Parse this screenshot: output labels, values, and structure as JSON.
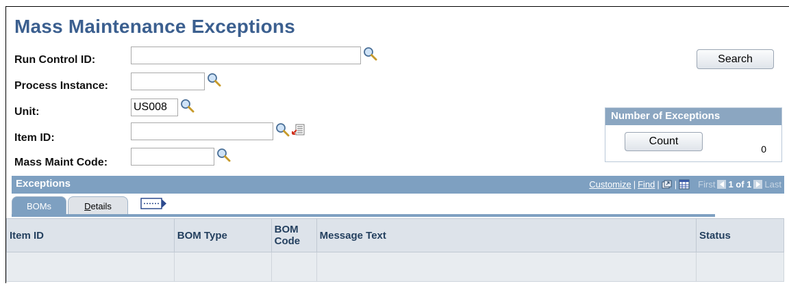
{
  "page": {
    "title": "Mass Maintenance Exceptions"
  },
  "form": {
    "run_control_id": {
      "label": "Run Control ID:",
      "value": ""
    },
    "process_instance": {
      "label": "Process Instance:",
      "value": ""
    },
    "unit": {
      "label": "Unit:",
      "value": "US008"
    },
    "item_id": {
      "label": "Item ID:",
      "value": ""
    },
    "mass_maint_code": {
      "label": "Mass Maint Code:",
      "value": ""
    }
  },
  "search_button": "Search",
  "number_of_exceptions": {
    "title": "Number of Exceptions",
    "count_button": "Count",
    "value": "0"
  },
  "exceptions": {
    "title": "Exceptions",
    "nav": {
      "customize": "Customize",
      "find": "Find",
      "first": "First",
      "page": "1 of 1",
      "last": "Last"
    },
    "tabs": [
      {
        "label": "BOMs"
      },
      {
        "label_prefix": "D",
        "label_rest": "etails"
      }
    ],
    "columns": [
      "Item ID",
      "BOM Type",
      "BOM Code",
      "Message Text",
      "Status"
    ],
    "rows": [
      [
        "",
        "",
        "",
        "",
        ""
      ]
    ]
  },
  "icons": {
    "lookup": "magnifier-icon",
    "detail": "item-detail-icon",
    "view_all": "view-all-icon",
    "download": "download-grid-icon",
    "show_all_columns": "show-all-columns-icon",
    "prev": "prev-arrow-icon",
    "next": "next-arrow-icon"
  },
  "colors": {
    "title": "#3b5f8f",
    "bar": "#7ea0c1",
    "box_head": "#8ba6c1"
  }
}
